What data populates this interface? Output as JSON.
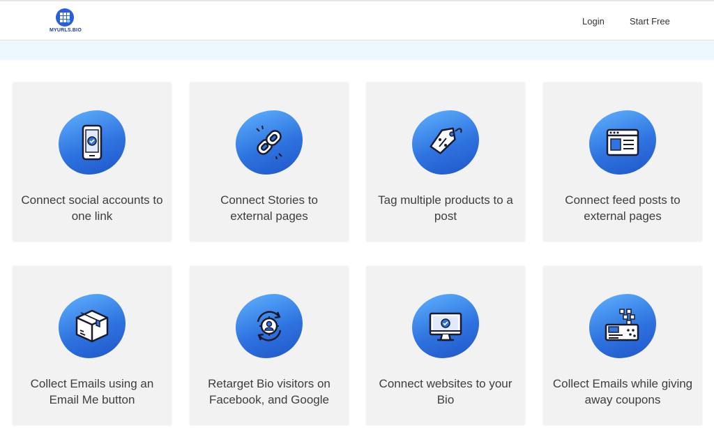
{
  "header": {
    "logo_text": "MYURLS.BIO",
    "nav": {
      "login": "Login",
      "start_free": "Start Free"
    }
  },
  "features": [
    {
      "label": "Connect social accounts to one link",
      "icon": "smartphone-check-icon"
    },
    {
      "label": "Connect Stories to external pages",
      "icon": "chain-link-icon"
    },
    {
      "label": "Tag multiple products to a post",
      "icon": "price-tag-icon"
    },
    {
      "label": "Connect feed posts to external pages",
      "icon": "browser-window-icon"
    },
    {
      "label": "Collect Emails using an Email Me button",
      "icon": "package-box-icon"
    },
    {
      "label": "Retarget Bio visitors on Facebook, and Google",
      "icon": "retarget-user-icon"
    },
    {
      "label": "Connect websites to your Bio",
      "icon": "monitor-check-icon"
    },
    {
      "label": "Collect Emails while giving away coupons",
      "icon": "coupon-card-icon"
    }
  ],
  "colors": {
    "accent_blue": "#2f74e0",
    "blob_light": "#60b3ff",
    "card_bg": "#f2f2f2",
    "banner_bg": "#ecf8fd",
    "text": "#3d3d3d"
  }
}
